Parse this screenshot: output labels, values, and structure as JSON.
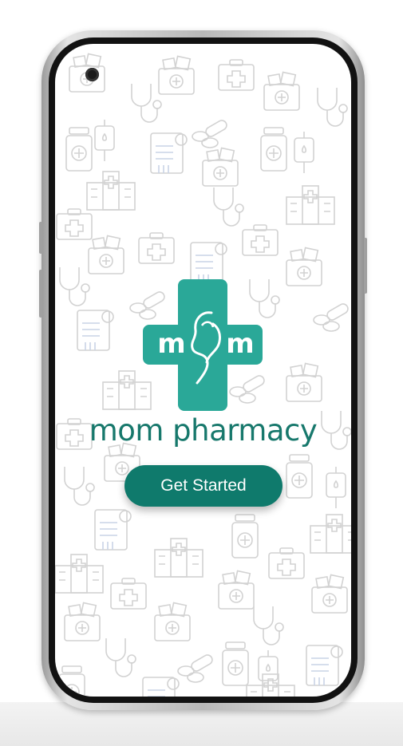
{
  "app": {
    "brand_name": "mom pharmacy",
    "logo_letters": {
      "left": "m",
      "right": "m"
    }
  },
  "actions": {
    "get_started_label": "Get Started"
  },
  "colors": {
    "brand_teal": "#17786c",
    "logo_cross": "#2aa898",
    "button": "#0f7a6c",
    "pattern_icons": "#d2d2d2"
  },
  "background_pattern_icons": [
    "medical-kit-icon",
    "pill-bottle-icon",
    "stethoscope-icon",
    "pills-icon",
    "hospital-icon",
    "clipboard-icon",
    "iv-bag-icon",
    "medicine-box-icon"
  ]
}
